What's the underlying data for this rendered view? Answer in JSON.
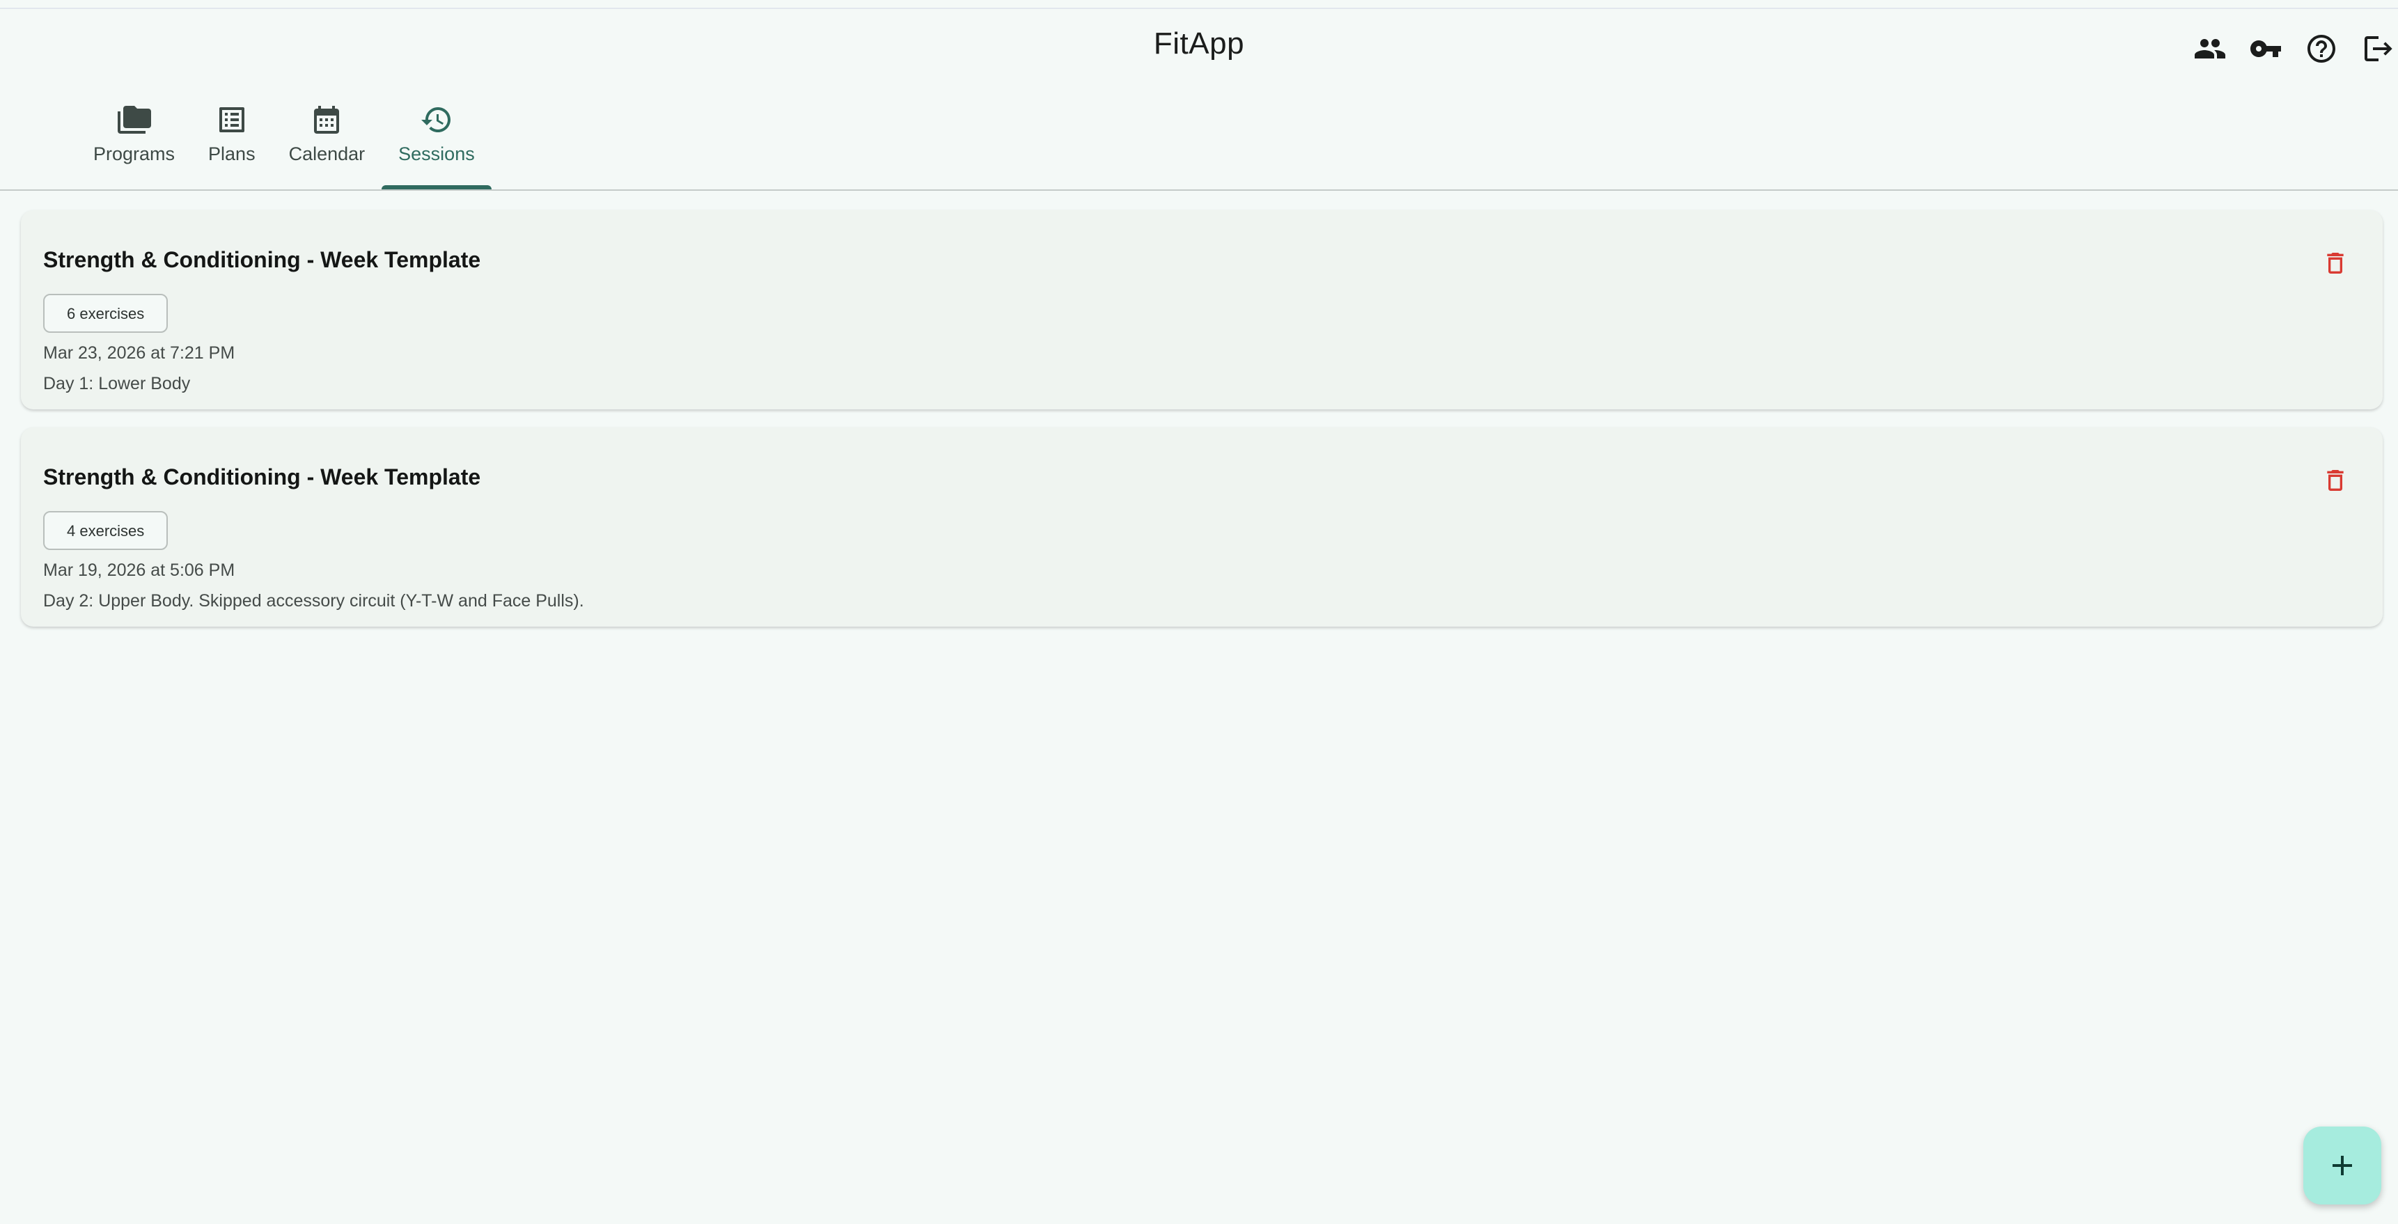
{
  "app": {
    "title": "FitApp"
  },
  "header": {
    "actions": [
      {
        "name": "users-icon",
        "label": "Users"
      },
      {
        "name": "key-icon",
        "label": "Key"
      },
      {
        "name": "help-icon",
        "label": "Help"
      },
      {
        "name": "logout-icon",
        "label": "Log out"
      }
    ]
  },
  "tabs": [
    {
      "label": "Programs",
      "icon": "folder-icon",
      "active": false
    },
    {
      "label": "Plans",
      "icon": "list-icon",
      "active": false
    },
    {
      "label": "Calendar",
      "icon": "calendar-icon",
      "active": false
    },
    {
      "label": "Sessions",
      "icon": "history-icon",
      "active": true
    }
  ],
  "sessions": [
    {
      "title": "Strength & Conditioning - Week Template",
      "exercises": "6 exercises",
      "date": "Mar 23, 2026 at 7:21 PM",
      "note": "Day 1: Lower Body"
    },
    {
      "title": "Strength & Conditioning - Week Template",
      "exercises": "4 exercises",
      "date": "Mar 19, 2026 at 5:06 PM",
      "note": "Day 2: Upper Body. Skipped accessory circuit (Y-T-W and Face Pulls)."
    }
  ],
  "fab": {
    "icon": "plus-icon"
  },
  "colors": {
    "background": "#f4f9f7",
    "accent": "#2f6b5f",
    "card": "#eff4f0",
    "delete": "#d93a32",
    "fab": "#a6ecde"
  }
}
